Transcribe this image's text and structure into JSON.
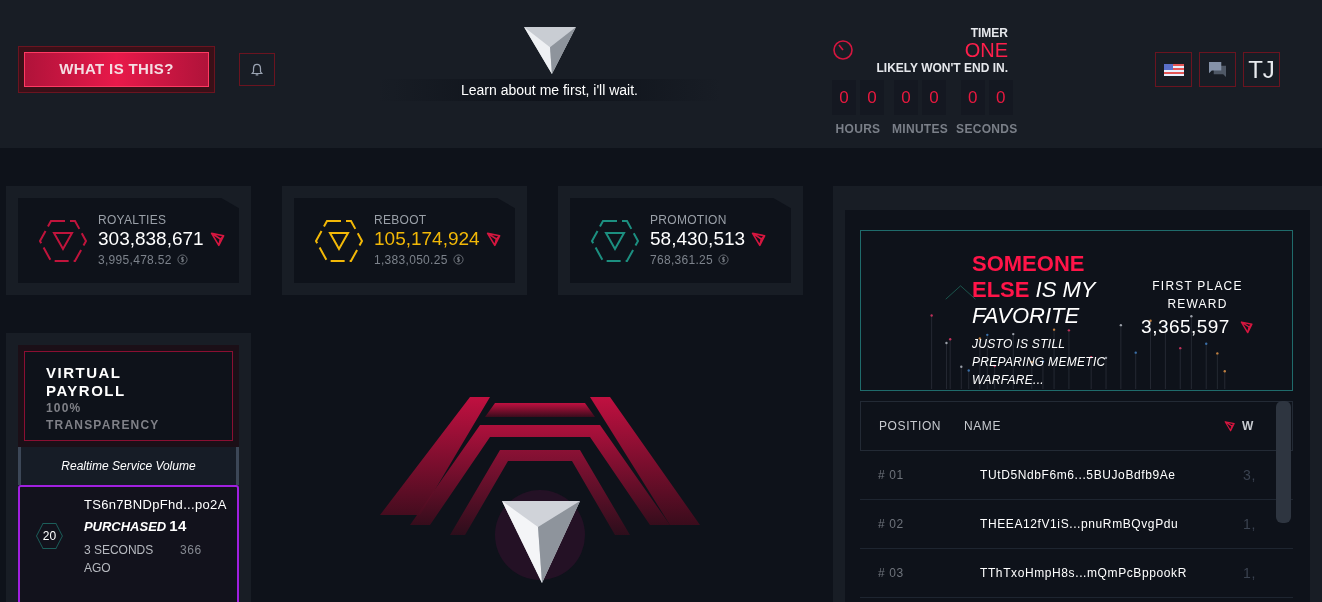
{
  "header": {
    "help_button": "WHAT IS THIS?",
    "tagline": "Learn about me first, i'll wait.",
    "timer": {
      "title": "TIMER",
      "name": "ONE",
      "subtitle": "LIKELY WON'T END IN.",
      "units": [
        {
          "label": "HOURS",
          "digits": [
            "0",
            "0"
          ]
        },
        {
          "label": "MINUTES",
          "digits": [
            "0",
            "0"
          ]
        },
        {
          "label": "SECONDS",
          "digits": [
            "0",
            "0"
          ]
        }
      ]
    },
    "user_initials": "TJ"
  },
  "stats": [
    {
      "label": "ROYALTIES",
      "value": "303,838,671",
      "usd": "3,995,478.52",
      "color": "#c0143c",
      "highlighted": false
    },
    {
      "label": "REBOOT",
      "value": "105,174,924",
      "usd": "1,383,050.25",
      "color": "#f2b807",
      "highlighted": true
    },
    {
      "label": "PROMOTION",
      "value": "58,430,513",
      "usd": "768,361.25",
      "color": "#1c8f80",
      "highlighted": false
    }
  ],
  "payroll": {
    "title_lines": [
      "VIRTUAL",
      "PAYROLL"
    ],
    "subtitle_lines": [
      "100%",
      "TRANSPARENCY"
    ],
    "section": "Realtime Service Volume",
    "purchase": {
      "level": "20",
      "address": "TS6n7BNDpFhd...po2A",
      "action": "PURCHASED",
      "amount": "14",
      "time": "3 SECONDS AGO",
      "number": "366"
    }
  },
  "banner": {
    "headline_strong_lines": [
      "SOMEONE",
      "ELSE"
    ],
    "headline_rest": "IS MY FAVORITE",
    "note": "JUSTO IS STILL PREPARING MEMETIC WARFARE...",
    "reward_label": "FIRST PLACE REWARD",
    "reward": "3,365,597"
  },
  "leaderboard": {
    "columns": [
      "POSITION",
      "NAME",
      "W"
    ],
    "rows": [
      {
        "position": "# 01",
        "name": "TUtD5NdbF6m6...5BUJoBdfb9Ae",
        "column_3": "3,"
      },
      {
        "position": "# 02",
        "name": "THEEA12fV1iS...pnuRmBQvgPdu",
        "column_3": "1,"
      },
      {
        "position": "# 03",
        "name": "TThTxoHmpH8s...mQmPcBppookR",
        "column_3": "1,"
      }
    ]
  }
}
